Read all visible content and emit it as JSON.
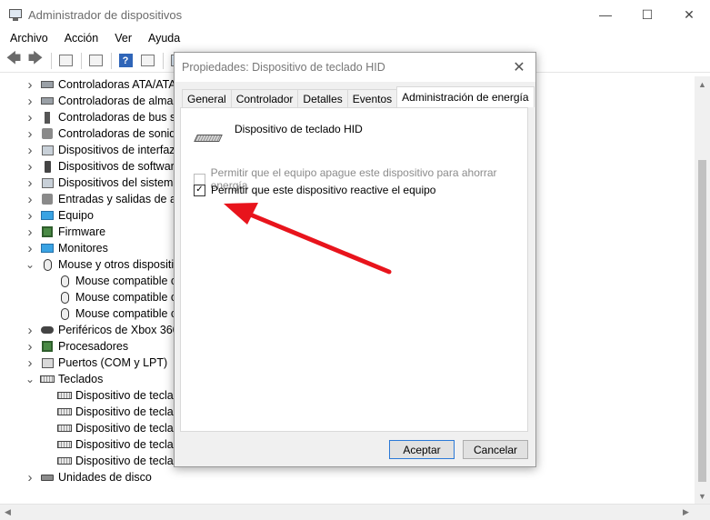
{
  "window": {
    "title": "Administrador de dispositivos"
  },
  "menu": [
    "Archivo",
    "Acción",
    "Ver",
    "Ayuda"
  ],
  "tree": [
    {
      "label": "Controladoras ATA/ATA",
      "icon": "drive-icon",
      "level": 0
    },
    {
      "label": "Controladoras de almac",
      "icon": "storage-icon",
      "level": 0
    },
    {
      "label": "Controladoras de bus se",
      "icon": "usb-icon",
      "level": 0
    },
    {
      "label": "Controladoras de sonido",
      "icon": "speaker-icon",
      "level": 0
    },
    {
      "label": "Dispositivos de interfaz c",
      "icon": "hid-icon",
      "level": 0
    },
    {
      "label": "Dispositivos de software",
      "icon": "phone-icon",
      "level": 0
    },
    {
      "label": "Dispositivos del sistema",
      "icon": "system-icon",
      "level": 0
    },
    {
      "label": "Entradas y salidas de au",
      "icon": "speaker-icon",
      "level": 0
    },
    {
      "label": "Equipo",
      "icon": "monitor-icon",
      "level": 0
    },
    {
      "label": "Firmware",
      "icon": "chip-icon",
      "level": 0
    },
    {
      "label": "Monitores",
      "icon": "monitor-icon",
      "level": 0
    },
    {
      "label": "Mouse y otros dispositiv",
      "icon": "mouse-icon",
      "level": 0,
      "expanded": true
    },
    {
      "label": "Mouse compatible c",
      "icon": "mouse-icon",
      "level": 1
    },
    {
      "label": "Mouse compatible c",
      "icon": "mouse-icon",
      "level": 1
    },
    {
      "label": "Mouse compatible c",
      "icon": "mouse-icon",
      "level": 1
    },
    {
      "label": "Periféricos de Xbox 360",
      "icon": "gamepad-icon",
      "level": 0
    },
    {
      "label": "Procesadores",
      "icon": "chip-icon",
      "level": 0
    },
    {
      "label": "Puertos (COM y LPT)",
      "icon": "port-icon",
      "level": 0
    },
    {
      "label": "Teclados",
      "icon": "keyboard-icon",
      "level": 0,
      "expanded": true
    },
    {
      "label": "Dispositivo de teclad",
      "icon": "keyboard-icon",
      "level": 1
    },
    {
      "label": "Dispositivo de teclad",
      "icon": "keyboard-icon",
      "level": 1
    },
    {
      "label": "Dispositivo de teclad",
      "icon": "keyboard-icon",
      "level": 1
    },
    {
      "label": "Dispositivo de teclad",
      "icon": "keyboard-icon",
      "level": 1
    },
    {
      "label": "Dispositivo de teclad",
      "icon": "keyboard-icon",
      "level": 1
    },
    {
      "label": "Unidades de disco",
      "icon": "disk-icon",
      "level": 0
    }
  ],
  "dialog": {
    "title": "Propiedades: Dispositivo de teclado HID",
    "tabs": [
      "General",
      "Controlador",
      "Detalles",
      "Eventos",
      "Administración de energía"
    ],
    "active_tab": 4,
    "device_name": "Dispositivo de teclado HID",
    "option1": {
      "label": "Permitir que el equipo apague este dispositivo para ahorrar energía",
      "checked": false,
      "enabled": false
    },
    "option2": {
      "label": "Permitir que este dispositivo reactive el equipo",
      "checked": true,
      "enabled": true
    },
    "ok_label": "Aceptar",
    "cancel_label": "Cancelar"
  },
  "colors": {
    "annotation_arrow": "#e8141c",
    "accent": "#2b79d7"
  }
}
